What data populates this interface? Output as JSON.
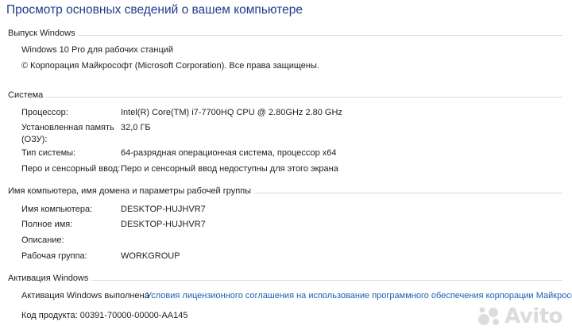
{
  "page": {
    "title": "Просмотр основных сведений о вашем компьютере"
  },
  "edition": {
    "header": "Выпуск Windows",
    "name": "Windows 10 Pro для рабочих станций",
    "copyright": "© Корпорация Майкрософт (Microsoft Corporation). Все права защищены."
  },
  "system": {
    "header": "Система",
    "rows": [
      {
        "label": "Процессор:",
        "value": "Intel(R) Core(TM) i7-7700HQ CPU @ 2.80GHz   2.80 GHz"
      },
      {
        "label": "Установленная память\n(ОЗУ):",
        "value": "32,0 ГБ"
      },
      {
        "label": "Тип системы:",
        "value": "64-разрядная операционная система, процессор x64"
      },
      {
        "label": "Перо и сенсорный ввод:",
        "value": "Перо и сенсорный ввод недоступны для этого экрана"
      }
    ]
  },
  "computer": {
    "header": "Имя компьютера, имя домена и параметры рабочей группы",
    "rows": [
      {
        "label": "Имя компьютера:",
        "value": "DESKTOP-HUJHVR7"
      },
      {
        "label": "Полное имя:",
        "value": "DESKTOP-HUJHVR7"
      },
      {
        "label": "Описание:",
        "value": ""
      },
      {
        "label": "Рабочая группа:",
        "value": "WORKGROUP"
      }
    ]
  },
  "activation": {
    "header": "Активация Windows",
    "status": "Активация Windows выполнена",
    "link": "Условия лицензионного соглашения на использование программного обеспечения корпорации Майкрософт",
    "product_id": "Код продукта: 00391-70000-00000-AA145"
  },
  "watermark": {
    "text": "Avito",
    "icon": "avito-logo-icon"
  }
}
